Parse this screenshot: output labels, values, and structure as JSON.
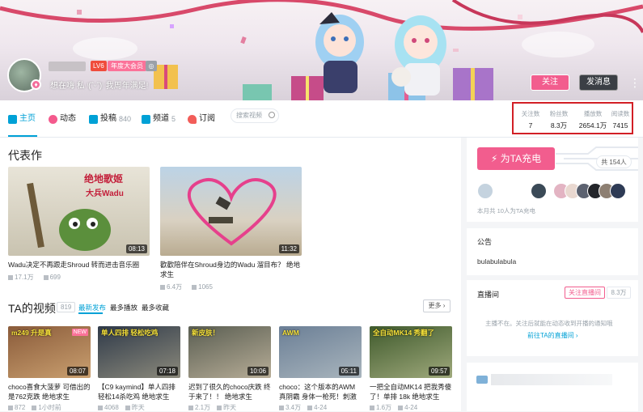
{
  "header": {
    "level_badge": "LV6",
    "vip_badge": "年度大会员",
    "signature": "想在嗨 私 ᵎ(ˆᵕˆ)ᵎ 我周年满足!",
    "follow_label": "关注",
    "message_label": "发消息",
    "more_icon": "⋮"
  },
  "nav": {
    "items": [
      {
        "label": "主页",
        "count": "",
        "icon": "home-icon",
        "color": "#00a1d6"
      },
      {
        "label": "动态",
        "count": "",
        "icon": "dynamic-icon",
        "color": "#f45a8d"
      },
      {
        "label": "投稿",
        "count": "840",
        "icon": "upload-icon",
        "color": "#00a1d6"
      },
      {
        "label": "频道",
        "count": "5",
        "icon": "channel-icon",
        "color": "#00a1d6"
      },
      {
        "label": "订阅",
        "count": "",
        "icon": "subscribe-icon",
        "color": "#f25d59"
      }
    ],
    "search_placeholder": "搜索视频"
  },
  "stats": [
    {
      "label": "关注数",
      "value": "7"
    },
    {
      "label": "粉丝数",
      "value": "8.3万"
    },
    {
      "label": "播放数",
      "value": "2654.1万"
    },
    {
      "label": "阅读数",
      "value": "7415"
    }
  ],
  "featured": {
    "title": "代表作",
    "videos": [
      {
        "title": "Wadu决定不再跟走Shroud 转而进击音乐圈",
        "duration": "08:13",
        "plays": "17.1万",
        "comments": "699",
        "thumb_text1": "绝地歌姬",
        "thumb_text2": "大兵Wadu"
      },
      {
        "title": "歡歡陪伴在Shroud身边的Wadu 溜目布？ 绝地求生",
        "duration": "11:32",
        "plays": "6.4万",
        "comments": "1065"
      }
    ]
  },
  "videos": {
    "title": "TA的视频",
    "count": "819",
    "tabs": [
      "最新发布",
      "最多播放",
      "最多收藏"
    ],
    "more_label": "更多 ›",
    "list": [
      {
        "title": "choco喜食大菠萝 可借出的是762克跌 绝地求生",
        "duration": "08:07",
        "plays": "872",
        "date": "1小时前",
        "tag": "NEW",
        "thumb_text": "m249 升是真"
      },
      {
        "title": "【C9 kaymind】单人四排 轻松14杀吃鸡 绝地求生",
        "duration": "07:18",
        "plays": "4068",
        "date": "昨天",
        "thumb_text": "单人四排 轻松吃鸡"
      },
      {
        "title": "迟到了很久的choco庆跌 终于来了！！ 绝地求生",
        "duration": "10:06",
        "plays": "2.1万",
        "date": "昨天",
        "thumb_text": "新皮肤！"
      },
      {
        "title": "choco：这个版本的AWM真阴霸 身体一枪死！刺激",
        "duration": "05:11",
        "plays": "3.4万",
        "date": "4-24",
        "thumb_text": "AWM"
      },
      {
        "title": "一把全自动MK14 把我秀傻了！单排 18k 绝地求生【Liquid",
        "duration": "09:57",
        "plays": "1.6万",
        "date": "4-24",
        "thumb_text": "全自动MK14 秀翻了"
      }
    ]
  },
  "sidebar": {
    "charge_label": "为TA充电",
    "charge_total": "共 154人",
    "month_text": "本月共 10人为TA充电",
    "notice_title": "公告",
    "notice_text": "bulabulabula",
    "live_title": "直播间",
    "live_follow_label": "关注直播间",
    "live_count": "8.3万",
    "live_message": "主播不在。关注后就能在动态收到开播的通知哦",
    "live_link": "前往TA的直播间 ›"
  }
}
